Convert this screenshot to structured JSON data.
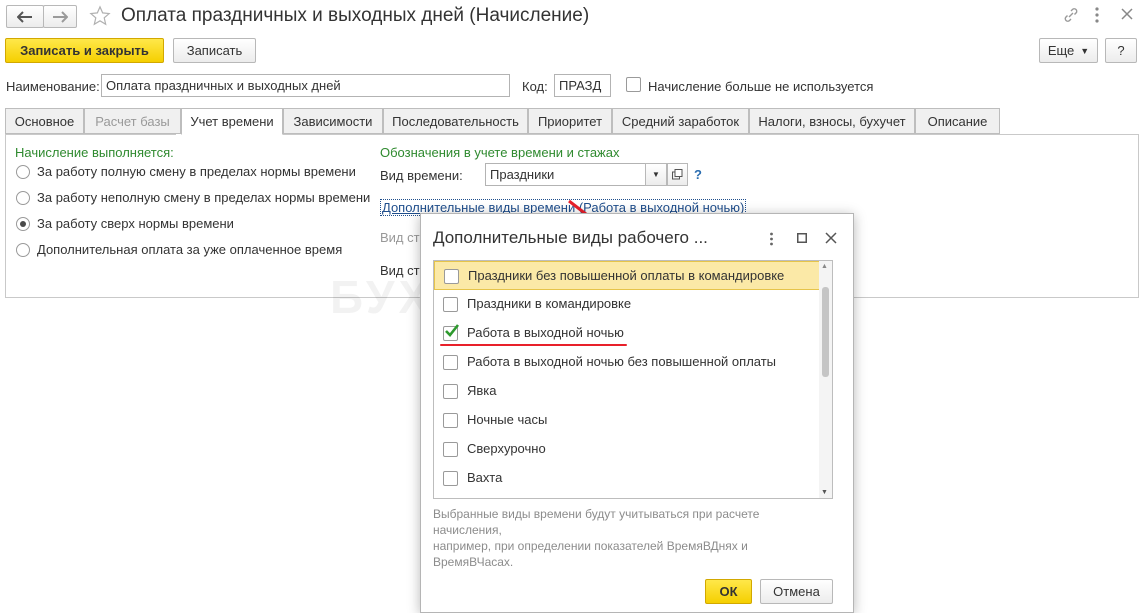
{
  "window": {
    "title": "Оплата праздничных и выходных дней (Начисление)"
  },
  "toolbar": {
    "save_close": "Записать и закрыть",
    "save": "Записать",
    "more": "Еще",
    "help": "?"
  },
  "fields": {
    "name_label": "Наименование:",
    "name_value": "Оплата праздничных и выходных дней",
    "code_label": "Код:",
    "code_value": "ПРАЗД",
    "unused_label": "Начисление больше не используется"
  },
  "tabs": [
    {
      "label": "Основное",
      "state": "normal"
    },
    {
      "label": "Расчет базы",
      "state": "disabled"
    },
    {
      "label": "Учет времени",
      "state": "active"
    },
    {
      "label": "Зависимости",
      "state": "normal"
    },
    {
      "label": "Последовательность",
      "state": "normal"
    },
    {
      "label": "Приоритет",
      "state": "normal"
    },
    {
      "label": "Средний заработок",
      "state": "normal"
    },
    {
      "label": "Налоги, взносы, бухучет",
      "state": "normal"
    },
    {
      "label": "Описание",
      "state": "normal"
    }
  ],
  "left_section": {
    "heading": "Начисление выполняется:",
    "options": [
      "За работу полную смену в пределах нормы времени",
      "За работу неполную смену в пределах нормы времени",
      "За работу сверх нормы времени",
      "Дополнительная оплата за уже оплаченное время"
    ],
    "selected_index": 2
  },
  "right_section": {
    "heading": "Обозначения в учете времени и стажах",
    "time_type_label": "Вид времени:",
    "time_type_value": "Праздники",
    "help": "?",
    "additional_link": "Дополнительные виды времени (Работа в выходной ночью)",
    "hidden_label_1": "Вид ст",
    "hidden_label_2": "Вид ст"
  },
  "dialog": {
    "title": "Дополнительные виды рабочего ...",
    "items": [
      {
        "label": "Праздники без повышенной оплаты в командировке",
        "checked": false
      },
      {
        "label": "Праздники в командировке",
        "checked": false
      },
      {
        "label": "Работа в выходной ночью",
        "checked": true
      },
      {
        "label": "Работа в выходной ночью без повышенной оплаты",
        "checked": false
      },
      {
        "label": "Явка",
        "checked": false
      },
      {
        "label": "Ночные часы",
        "checked": false
      },
      {
        "label": "Сверхурочно",
        "checked": false
      },
      {
        "label": "Вахта",
        "checked": false
      }
    ],
    "hint_line1": "Выбранные виды времени будут учитываться при расчете",
    "hint_line2": "начисления,",
    "hint_line3": "например, при определении показателей ВремяВДнях и",
    "hint_line4": "ВремяВЧасах.",
    "ok": "ОК",
    "cancel": "Отмена"
  },
  "watermark": "БУХЭКСПЕРТ",
  "colors": {
    "primary_button": "#f5cf00",
    "selected_row": "#fbe9a7",
    "green_heading": "#2f8a2f",
    "link": "#1f4e8c",
    "annotation_red": "#e8202a"
  }
}
